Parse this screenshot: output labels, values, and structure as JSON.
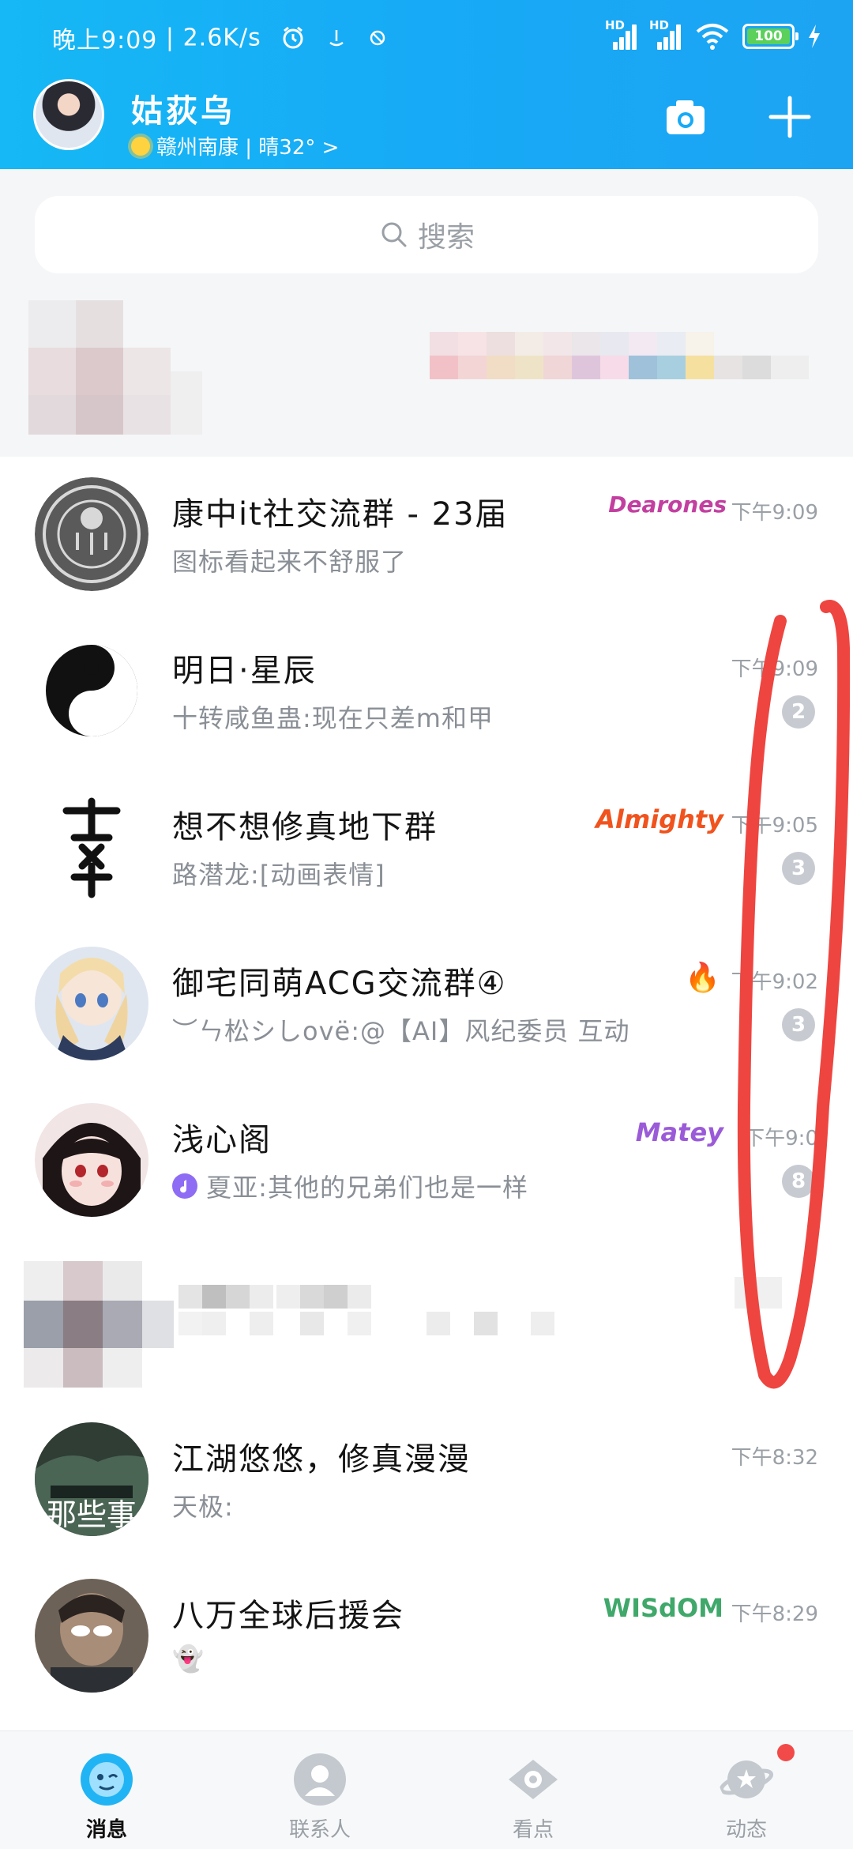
{
  "status_bar": {
    "time": "晚上9:09",
    "speed": "2.6K/s",
    "battery": "100",
    "signal_1_label": "HD",
    "signal_2_label": "HD"
  },
  "header": {
    "nickname": "姑荻乌",
    "weather": "赣州南康 | 晴32° >",
    "icons": [
      "camera-icon",
      "plus-icon"
    ]
  },
  "search": {
    "placeholder": "搜索"
  },
  "chats": [
    {
      "name": "康中it社交流群 - 23届",
      "message": "图标看起来不舒服了",
      "time": "下午9:09",
      "tag": "Dearones",
      "badge": ""
    },
    {
      "name": "明日·星辰",
      "message": "十转咸鱼蛊:现在只差m和甲",
      "time": "下午9:09",
      "tag": "",
      "badge": "2"
    },
    {
      "name": "想不想修真地下群",
      "message": "路潜龙:[动画表情]",
      "time": "下午9:05",
      "tag": "Almighty",
      "badge": "3"
    },
    {
      "name": "御宅同萌ACG交流群④",
      "message": "︶ㄣ松シしovë:@【AI】风纪委员 互动",
      "time": "下午9:02",
      "tag": "🔥",
      "badge": "3"
    },
    {
      "name": "浅心阁",
      "message": "夏亚:其他的兄弟们也是一样",
      "time": "下午9:0",
      "tag": "Matey",
      "badge": "8"
    },
    {
      "name": "江湖悠悠，修真漫漫",
      "message": "天极:",
      "time": "下午8:32",
      "tag": "",
      "badge": ""
    },
    {
      "name": "八万全球后援会",
      "message": "👻",
      "time": "下午8:29",
      "tag": "WISdOM",
      "badge": ""
    }
  ],
  "nav": [
    {
      "label": "消息",
      "icon": "message-icon"
    },
    {
      "label": "联系人",
      "icon": "contacts-icon"
    },
    {
      "label": "看点",
      "icon": "eye-icon"
    },
    {
      "label": "动态",
      "icon": "planet-icon"
    }
  ],
  "colors": {
    "header_bg": "#17aaf6",
    "accent_red": "#f24a48",
    "badge_gray": "#c7cbd1"
  }
}
